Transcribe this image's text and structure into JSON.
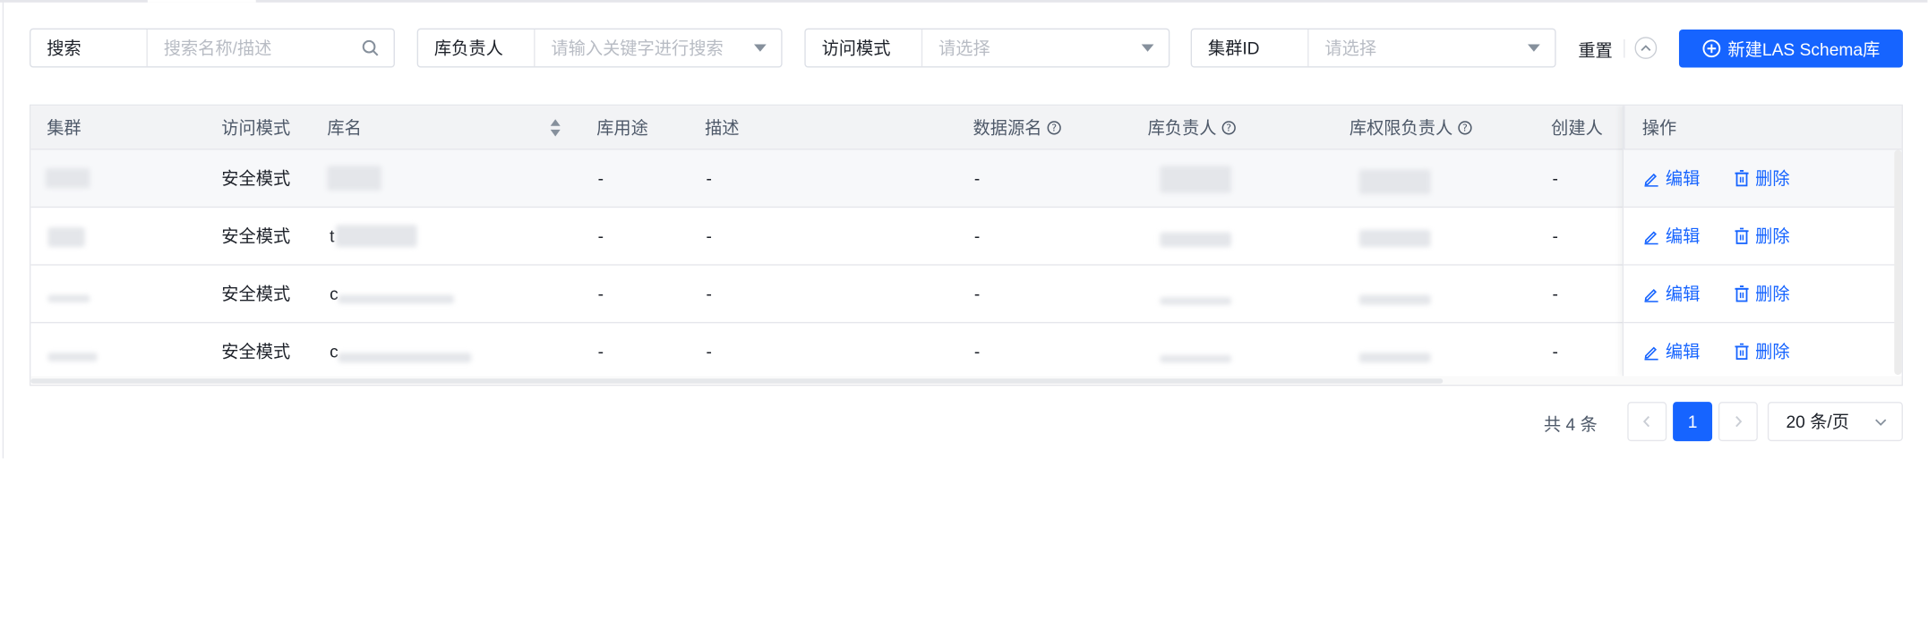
{
  "filters": {
    "search": {
      "label": "搜索",
      "placeholder": "搜索名称/描述"
    },
    "owner": {
      "label": "库负责人",
      "placeholder": "请输入关键字进行搜索"
    },
    "access_mode": {
      "label": "访问模式",
      "placeholder": "请选择"
    },
    "cluster_id": {
      "label": "集群ID",
      "placeholder": "请选择"
    },
    "reset_label": "重置",
    "create_label": "新建LAS Schema库"
  },
  "table": {
    "headers": {
      "cluster": "集群",
      "access_mode": "访问模式",
      "db_name": "库名",
      "db_usage": "库用途",
      "description": "描述",
      "datasource": "数据源名",
      "db_owner": "库负责人",
      "perm_owner": "库权限负责人",
      "creator": "创建人",
      "actions": "操作"
    },
    "rows": [
      {
        "access_mode": "安全模式",
        "db_prefix": "",
        "usage": "-",
        "desc": "-",
        "datasource": "-",
        "creator": "-",
        "edit": "编辑",
        "delete": "删除"
      },
      {
        "access_mode": "安全模式",
        "db_prefix": "t",
        "usage": "-",
        "desc": "-",
        "datasource": "-",
        "creator": "-",
        "edit": "编辑",
        "delete": "删除"
      },
      {
        "access_mode": "安全模式",
        "db_prefix": "c",
        "usage": "-",
        "desc": "-",
        "datasource": "-",
        "creator": "-",
        "edit": "编辑",
        "delete": "删除"
      },
      {
        "access_mode": "安全模式",
        "db_prefix": "c",
        "usage": "-",
        "desc": "-",
        "datasource": "-",
        "creator": "-",
        "edit": "编辑",
        "delete": "删除"
      }
    ]
  },
  "pagination": {
    "total_text": "共 4 条",
    "current_page": "1",
    "page_size": "20 条/页"
  },
  "colors": {
    "primary": "#1664ff",
    "border": "#e5e6eb",
    "header_bg": "#f2f3f5"
  }
}
